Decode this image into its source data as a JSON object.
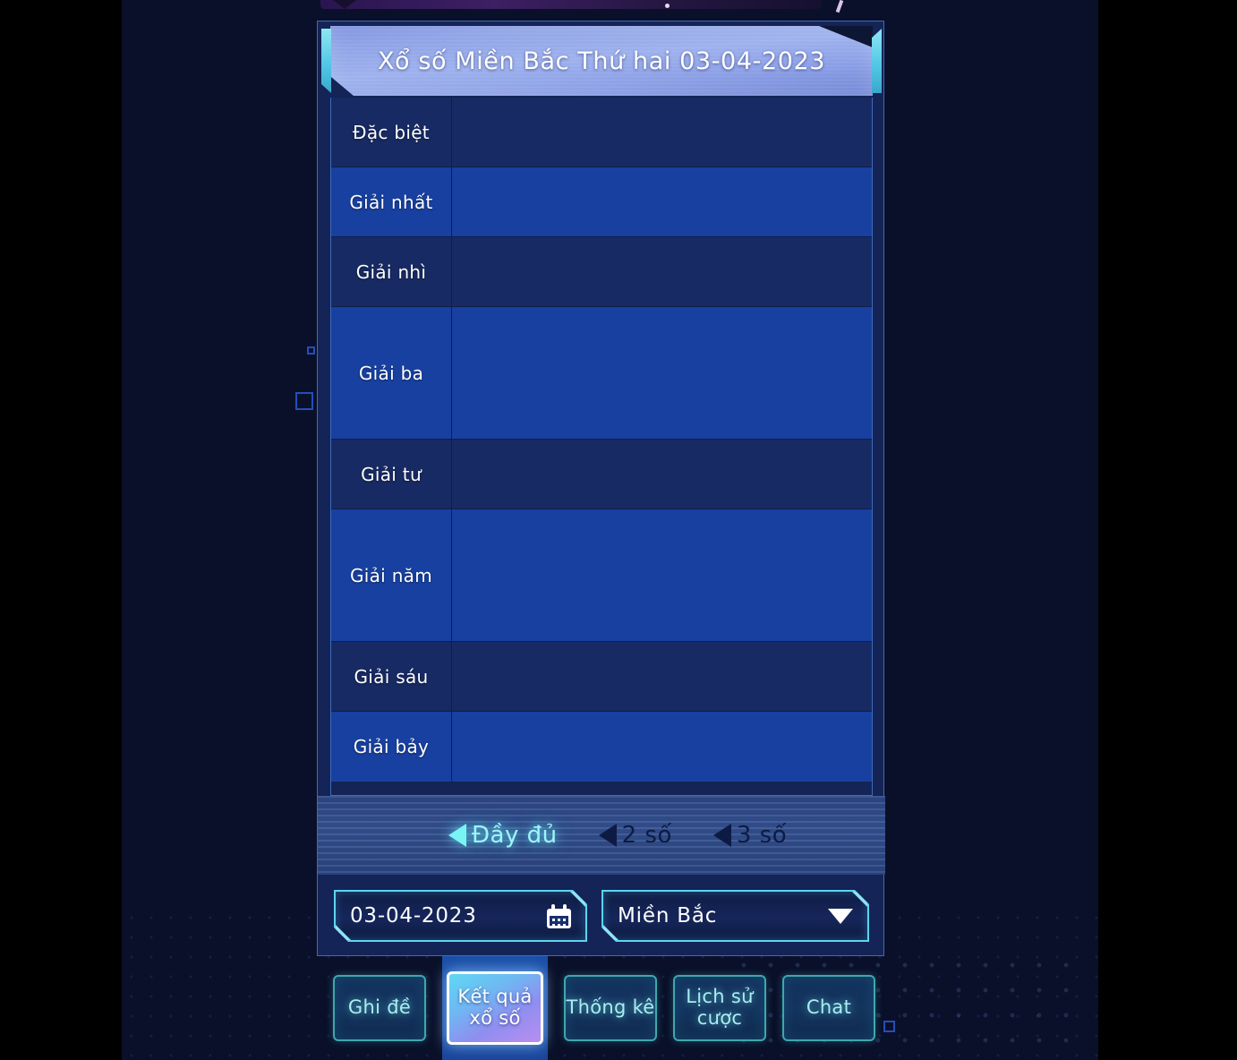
{
  "header": {
    "title": "Xổ số Miền Bắc Thứ hai 03-04-2023"
  },
  "results_table": {
    "rows": [
      {
        "label": "Đặc biệt",
        "value": ""
      },
      {
        "label": "Giải nhất",
        "value": ""
      },
      {
        "label": "Giải nhì",
        "value": ""
      },
      {
        "label": "Giải ba",
        "value": ""
      },
      {
        "label": "Giải tư",
        "value": ""
      },
      {
        "label": "Giải năm",
        "value": ""
      },
      {
        "label": "Giải sáu",
        "value": ""
      },
      {
        "label": "Giải bảy",
        "value": ""
      }
    ]
  },
  "filters": {
    "options": [
      {
        "label": "Đầy đủ",
        "selected": true
      },
      {
        "label": "2 số",
        "selected": false
      },
      {
        "label": "3 số",
        "selected": false
      }
    ]
  },
  "controls": {
    "date": {
      "value": "03-04-2023",
      "placeholder": "dd-mm-yyyy",
      "icon": "calendar-icon"
    },
    "region": {
      "value": "Miền Bắc",
      "icon": "chevron-down-icon"
    }
  },
  "navigation": {
    "items": [
      {
        "label": "Ghi đề",
        "active": false
      },
      {
        "label": "Kết quả\nxổ số",
        "active": true
      },
      {
        "label": "Thống kê",
        "active": false
      },
      {
        "label": "Lịch sử\ncược",
        "active": false
      },
      {
        "label": "Chat",
        "active": false
      }
    ]
  },
  "colors": {
    "accent_cyan": "#5fd4f0",
    "row_dark": "#172a63",
    "row_light": "#1840a0",
    "panel_border": "#3f6bb8",
    "background": "#0a1029"
  }
}
